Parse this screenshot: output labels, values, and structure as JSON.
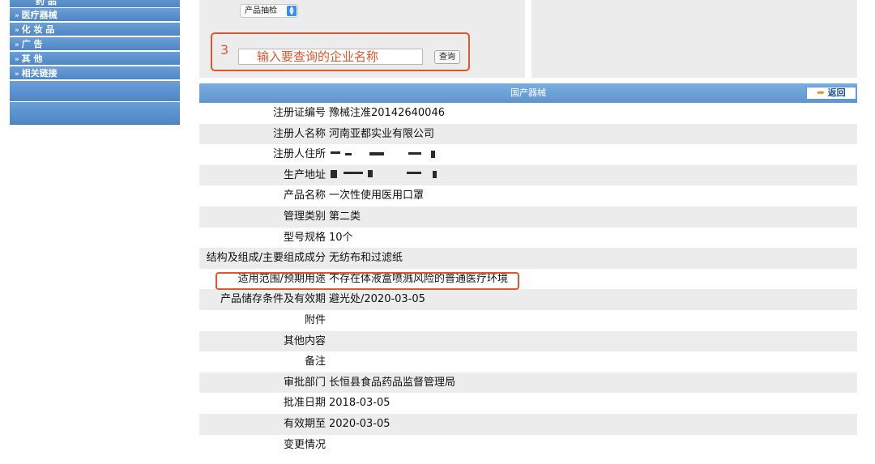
{
  "sidebar": {
    "top_partial": "药 品",
    "items": [
      {
        "label": "医疗器械"
      },
      {
        "label": "化 妆 品"
      },
      {
        "label": "广 告"
      },
      {
        "label": "其 他"
      },
      {
        "label": "相关链接"
      }
    ]
  },
  "search": {
    "select_value": "产品抽检",
    "step_number": "3",
    "input_value": "输入要查询的企业名称",
    "button_label": "查询"
  },
  "table": {
    "header": "国产器械",
    "back_label": "返回",
    "rows": [
      {
        "label": "注册证编号",
        "value": "豫械注准20142640046",
        "highlight": false
      },
      {
        "label": "注册人名称",
        "value": "河南亚都实业有限公司",
        "highlight": false
      },
      {
        "label": "注册人住所",
        "value": "",
        "highlight": false,
        "blurred": true
      },
      {
        "label": "生产地址",
        "value": "",
        "highlight": false,
        "blurred": true
      },
      {
        "label": "产品名称",
        "value": "一次性使用医用口罩",
        "highlight": false
      },
      {
        "label": "管理类别",
        "value": "第二类",
        "highlight": false
      },
      {
        "label": "型号规格",
        "value": "10个",
        "highlight": false
      },
      {
        "label": "结构及组成/主要组成成分",
        "value": "无纺布和过滤纸",
        "highlight": false
      },
      {
        "label": "适用范围/预期用途",
        "value": "不存在体液盒喷溅风险的普通医疗环境",
        "highlight": true
      },
      {
        "label": "产品储存条件及有效期",
        "value": "避光处/2020-03-05",
        "highlight": false
      },
      {
        "label": "附件",
        "value": "",
        "highlight": false
      },
      {
        "label": "其他内容",
        "value": "",
        "highlight": false
      },
      {
        "label": "备注",
        "value": "",
        "highlight": false
      },
      {
        "label": "审批部门",
        "value": "长恒县食品药品监督管理局",
        "highlight": false
      },
      {
        "label": "批准日期",
        "value": "2018-03-05",
        "highlight": false
      },
      {
        "label": "有效期至",
        "value": "2020-03-05",
        "highlight": false
      },
      {
        "label": "变更情况",
        "value": "",
        "highlight": false
      }
    ]
  },
  "colors": {
    "sidebar_bg": "#5b8fc7",
    "header_bg": "#6a9fd4",
    "highlight_border": "#e0552b",
    "input_text": "#e0552b",
    "row_alt": "#ececec"
  }
}
